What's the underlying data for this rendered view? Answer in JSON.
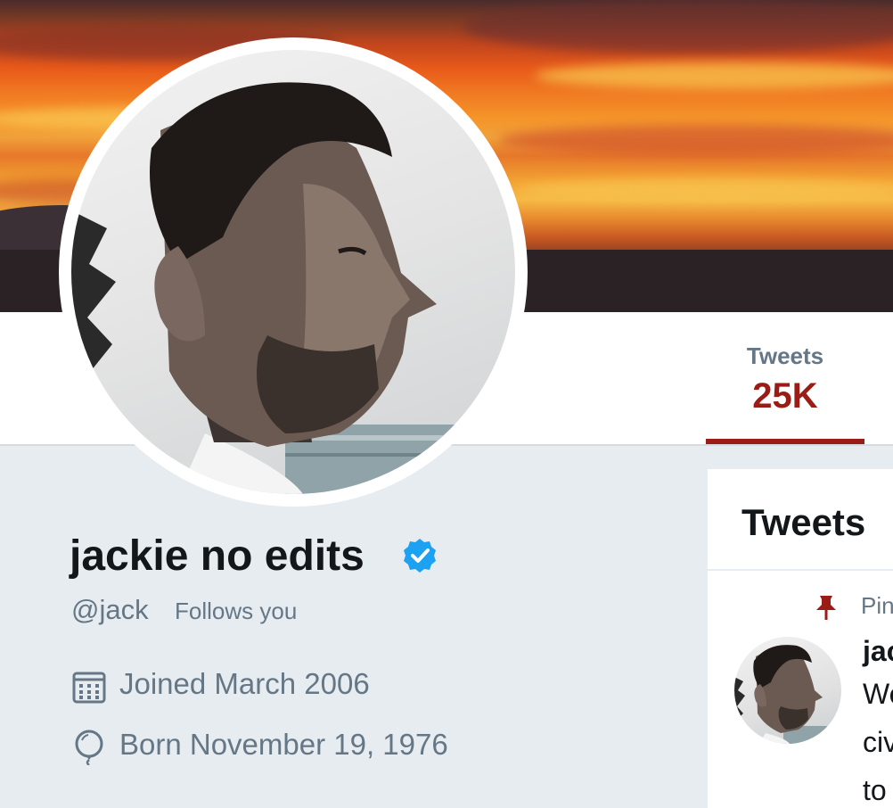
{
  "profile": {
    "display_name": "jackie no edits",
    "verified_icon": "verified-badge-icon",
    "handle": "@jack",
    "follows_you": "Follows you",
    "joined": "Joined March 2006",
    "born": "Born November 19, 1976"
  },
  "nav": {
    "tabs": [
      {
        "label": "Tweets",
        "count": "25K",
        "active": true
      }
    ]
  },
  "timeline": {
    "title": "Tweets",
    "pinned_label": "Pin",
    "tweet": {
      "author": "jac",
      "text_lines": [
        "We",
        "civ",
        "to"
      ]
    }
  },
  "colors": {
    "accent": "#9b1c14",
    "muted": "#657786",
    "text": "#14171a",
    "verified": "#1da1f2",
    "background": "#e6ecf0"
  }
}
